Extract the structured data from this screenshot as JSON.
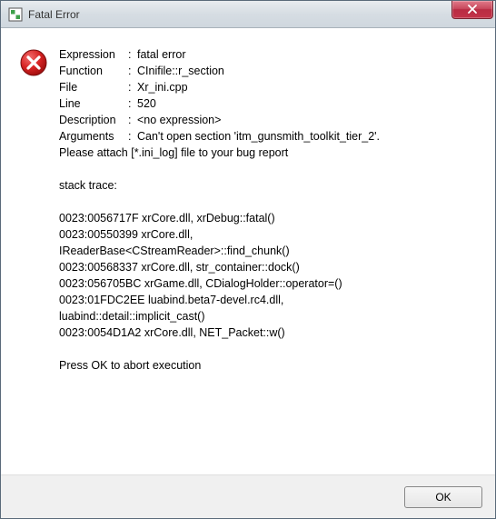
{
  "window": {
    "title": "Fatal Error"
  },
  "fields": {
    "expression": {
      "key": "Expression",
      "val": "fatal error"
    },
    "function": {
      "key": "Function",
      "val": "CInifile::r_section"
    },
    "file": {
      "key": "File",
      "val": "Xr_ini.cpp"
    },
    "line": {
      "key": "Line",
      "val": "520"
    },
    "description": {
      "key": "Description",
      "val": "<no expression>"
    },
    "arguments": {
      "key": "Arguments",
      "val": "Can't open section 'itm_gunsmith_toolkit_tier_2'."
    }
  },
  "attach_line": "Please attach [*.ini_log] file to your bug report",
  "stack_header": "stack trace:",
  "stack": [
    "0023:0056717F xrCore.dll, xrDebug::fatal()",
    "0023:00550399 xrCore.dll,",
    "IReaderBase<CStreamReader>::find_chunk()",
    "0023:00568337 xrCore.dll, str_container::dock()",
    "0023:056705BC xrGame.dll, CDialogHolder::operator=()",
    "0023:01FDC2EE luabind.beta7-devel.rc4.dll,",
    "luabind::detail::implicit_cast()",
    "0023:0054D1A2 xrCore.dll, NET_Packet::w()"
  ],
  "press_ok": "Press OK to abort execution",
  "buttons": {
    "ok": "OK"
  }
}
